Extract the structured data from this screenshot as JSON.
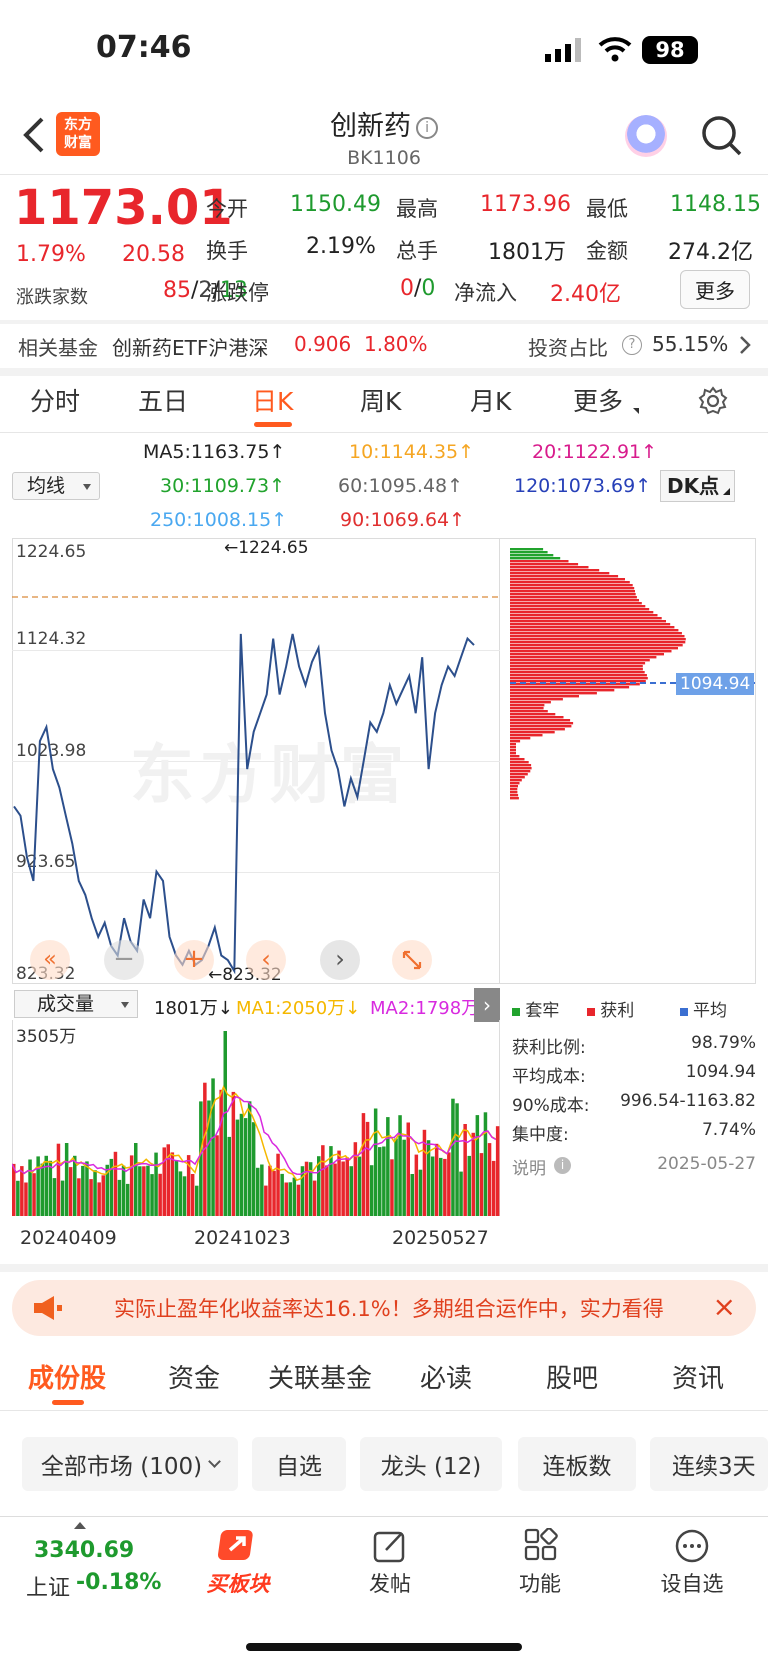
{
  "status_bar": {
    "time": "07:46",
    "battery": "98"
  },
  "header": {
    "title": "创新药",
    "code": "BK1106",
    "logo_line1": "东方",
    "logo_line2": "财富"
  },
  "quote": {
    "price": "1173.01",
    "change_pct": "1.79%",
    "change": "20.58",
    "open_label": "今开",
    "open": "1150.49",
    "high_label": "最高",
    "high": "1173.96",
    "low_label": "最低",
    "low": "1148.15",
    "turnover_label": "换手",
    "turnover": "2.19%",
    "volume_label": "总手",
    "volume": "1801万",
    "amount_label": "金额",
    "amount": "274.2亿",
    "updown_label": "涨跌家数",
    "up": "85",
    "flat": "2",
    "down": "13",
    "limit_label": "涨跌停",
    "limit_up": "0",
    "limit_down": "0",
    "netflow_label": "净流入",
    "netflow": "2.40亿",
    "more": "更多"
  },
  "fund_row": {
    "label": "相关基金",
    "fund_name": "创新药ETF沪港深",
    "fund_price": "0.906",
    "fund_pct": "1.80%",
    "ratio_label": "投资占比",
    "ratio": "55.15%"
  },
  "tabs": [
    "分时",
    "五日",
    "日K",
    "周K",
    "月K",
    "更多"
  ],
  "ma": {
    "selector": "均线",
    "dk": "DK点",
    "ma5": "MA5:1163.75↑",
    "ma10": "10:1144.35↑",
    "ma20": "20:1122.91↑",
    "ma30": "30:1109.73↑",
    "ma60": "60:1095.48↑",
    "ma120": "120:1073.69↑",
    "ma250": "250:1008.15↑",
    "ma90": "90:1069.64↑"
  },
  "price_axis": [
    "1224.65",
    "1124.32",
    "1023.98",
    "923.65",
    "823.32"
  ],
  "price_marks": {
    "high": "←1224.65",
    "low": "←823.32",
    "avg_cost_tag": "1094.94"
  },
  "watermark": "东方财富",
  "volume": {
    "selector": "成交量",
    "vol": "1801万↓",
    "ma1": "MA1:2050万↓",
    "ma2": "MA2:1798万↑",
    "max": "3505万",
    "dates": [
      "20240409",
      "20241023",
      "20250527"
    ]
  },
  "chip_stats": {
    "legend": [
      "套牢",
      "获利",
      "平均"
    ],
    "profit_ratio_label": "获利比例:",
    "profit_ratio": "98.79%",
    "avg_cost_label": "平均成本:",
    "avg_cost": "1094.94",
    "cost90_label": "90%成本:",
    "cost90": "996.54-1163.82",
    "concentration_label": "集中度:",
    "concentration": "7.74%",
    "note_label": "说明",
    "date": "2025-05-27"
  },
  "banner": {
    "text": "实际止盈年化收益率达16.1%！多期组合运作中，实力看得"
  },
  "bottom_tabs": [
    "成份股",
    "资金",
    "关联基金",
    "必读",
    "股吧",
    "资讯"
  ],
  "chips": [
    "全部市场 (100)",
    "自选",
    "龙头 (12)",
    "连板数",
    "连续3天"
  ],
  "bottom_nav": {
    "index_value": "3340.69",
    "index_name": "上证",
    "index_change": "-0.18%",
    "buy": "买板块",
    "post": "发帖",
    "func": "功能",
    "watch": "设自选"
  },
  "chart_data": {
    "type": "line",
    "title": "",
    "ylim": [
      823.32,
      1224.65
    ],
    "x": [
      "20240409",
      "20241023",
      "20250527"
    ],
    "series": [
      {
        "name": "",
        "values": [
          1000,
          990,
          945,
          920,
          1070,
          1085,
          1040,
          1020,
          990,
          960,
          920,
          905,
          880,
          860,
          875,
          850,
          840,
          880,
          855,
          845,
          900,
          880,
          930,
          920,
          860,
          840,
          830,
          845,
          830,
          835,
          850,
          870,
          840,
          835,
          823.32,
          1185,
          1040,
          1080,
          1100,
          1120,
          1180,
          1120,
          1150,
          1185,
          1150,
          1130,
          1155,
          1170,
          1100,
          1060,
          1040,
          1000,
          1030,
          1010,
          1050,
          1090,
          1080,
          1100,
          1130,
          1110,
          1125,
          1140,
          1100,
          1160,
          1040,
          1100,
          1130,
          1150,
          1140,
          1160,
          1180,
          1173
        ]
      }
    ]
  }
}
